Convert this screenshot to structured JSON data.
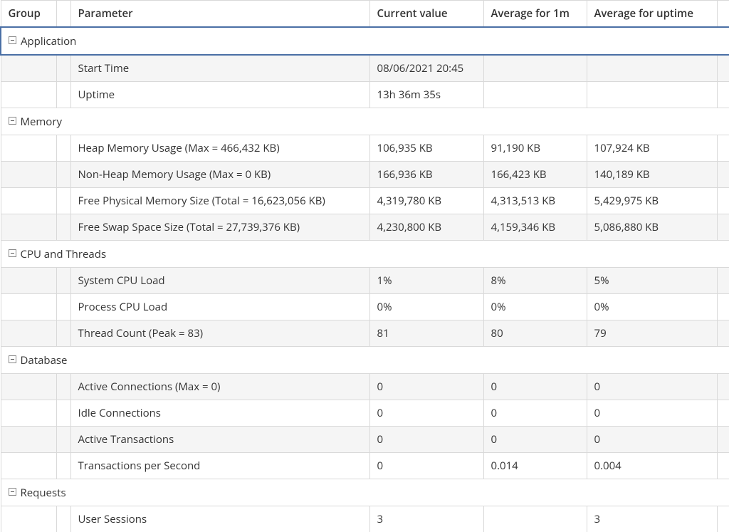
{
  "headers": {
    "group": "Group",
    "parameter": "Parameter",
    "current": "Current value",
    "avg1m": "Average for 1m",
    "uptime": "Average for uptime"
  },
  "groups": [
    {
      "name": "Application",
      "selected": true,
      "rows": [
        {
          "param": "Start Time",
          "current": "08/06/2021 20:45",
          "avg1m": "",
          "uptime": "",
          "even": true
        },
        {
          "param": "Uptime",
          "current": "13h 36m 35s",
          "avg1m": "",
          "uptime": "",
          "even": false
        }
      ]
    },
    {
      "name": "Memory",
      "rows": [
        {
          "param": "Heap Memory Usage (Max = 466,432 KB)",
          "current": "106,935 KB",
          "avg1m": "91,190 KB",
          "uptime": "107,924 KB",
          "even": false
        },
        {
          "param": "Non-Heap Memory Usage (Max = 0 KB)",
          "current": "166,936 KB",
          "avg1m": "166,423 KB",
          "uptime": "140,189 KB",
          "even": true
        },
        {
          "param": "Free Physical Memory Size (Total = 16,623,056 KB)",
          "current": "4,319,780 KB",
          "avg1m": "4,313,513 KB",
          "uptime": "5,429,975 KB",
          "even": false
        },
        {
          "param": "Free Swap Space Size (Total = 27,739,376 KB)",
          "current": "4,230,800 KB",
          "avg1m": "4,159,346 KB",
          "uptime": "5,086,880 KB",
          "even": true
        }
      ]
    },
    {
      "name": "CPU and Threads",
      "rows": [
        {
          "param": "System CPU Load",
          "current": "1%",
          "avg1m": "8%",
          "uptime": "5%",
          "even": true
        },
        {
          "param": "Process CPU Load",
          "current": "0%",
          "avg1m": "0%",
          "uptime": "0%",
          "even": false
        },
        {
          "param": "Thread Count (Peak = 83)",
          "current": "81",
          "avg1m": "80",
          "uptime": "79",
          "even": true
        }
      ]
    },
    {
      "name": "Database",
      "rows": [
        {
          "param": "Active Connections (Max = 0)",
          "current": "0",
          "avg1m": "0",
          "uptime": "0",
          "even": true
        },
        {
          "param": "Idle Connections",
          "current": "0",
          "avg1m": "0",
          "uptime": "0",
          "even": false
        },
        {
          "param": "Active Transactions",
          "current": "0",
          "avg1m": "0",
          "uptime": "0",
          "even": true
        },
        {
          "param": "Transactions per Second",
          "current": "0",
          "avg1m": "0.014",
          "uptime": "0.004",
          "even": false
        }
      ]
    },
    {
      "name": "Requests",
      "rows": [
        {
          "param": "User Sessions",
          "current": "3",
          "avg1m": "",
          "uptime": "3",
          "even": false,
          "partial": true
        }
      ]
    }
  ]
}
